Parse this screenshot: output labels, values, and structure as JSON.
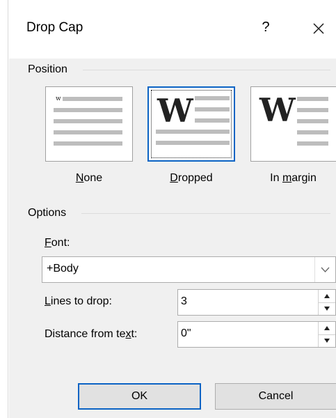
{
  "dialog": {
    "title": "Drop Cap",
    "help_label": "?"
  },
  "position": {
    "group_label": "Position",
    "options": [
      {
        "label_access": "N",
        "label_rest": "one",
        "selected": false
      },
      {
        "label_access": "D",
        "label_rest": "ropped",
        "selected": true
      },
      {
        "label_pre": "In ",
        "label_access": "m",
        "label_rest": "argin",
        "selected": false
      }
    ],
    "drop_letter": "W",
    "small_letter": "w"
  },
  "options": {
    "group_label": "Options",
    "font": {
      "label_access": "F",
      "label_rest": "ont:",
      "value": "+Body"
    },
    "lines_to_drop": {
      "label_access": "L",
      "label_rest": "ines to drop:",
      "value": "3"
    },
    "distance": {
      "label_pre": "Distance from te",
      "label_access": "x",
      "label_rest": "t:",
      "value": "0\""
    }
  },
  "buttons": {
    "ok_label": "OK",
    "cancel_label": "Cancel"
  },
  "colors": {
    "accent": "#0b63c4",
    "panel": "#f0f0f0",
    "line_gray": "#bdbdbd"
  }
}
